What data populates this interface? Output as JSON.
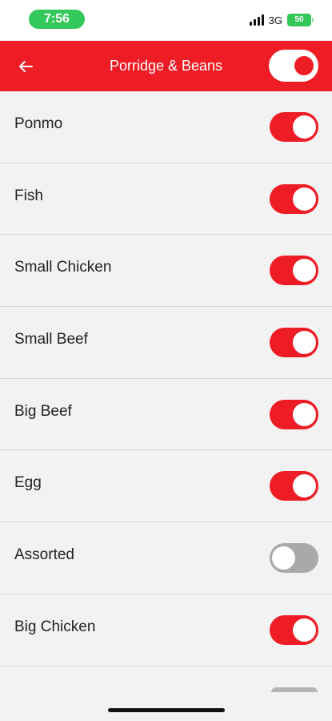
{
  "status_bar": {
    "time": "7:56",
    "network": "3G",
    "battery": "50"
  },
  "header": {
    "title": "Porridge & Beans",
    "toggle_on": true
  },
  "items": [
    {
      "label": "Ponmo",
      "enabled": true
    },
    {
      "label": "Fish",
      "enabled": true
    },
    {
      "label": "Small Chicken",
      "enabled": true
    },
    {
      "label": "Small Beef",
      "enabled": true
    },
    {
      "label": "Big Beef",
      "enabled": true
    },
    {
      "label": "Egg",
      "enabled": true
    },
    {
      "label": "Assorted",
      "enabled": false
    },
    {
      "label": "Big Chicken",
      "enabled": true
    }
  ],
  "colors": {
    "accent": "#ee1c25",
    "toggle_off": "#a9a9a9",
    "background": "#f2f2f2",
    "status_green": "#34c759"
  }
}
